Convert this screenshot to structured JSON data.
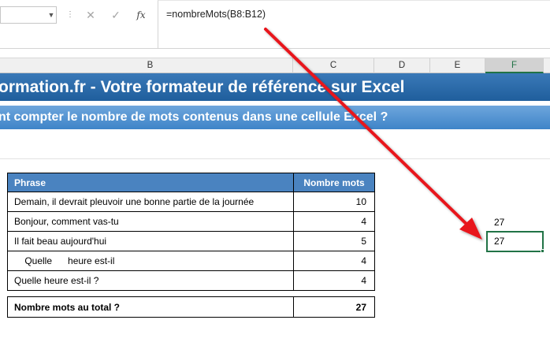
{
  "formula_bar": {
    "name_box_value": "",
    "cancel_icon": "✕",
    "enter_icon": "✓",
    "fx_label": "fx",
    "formula": "=nombreMots(B8:B12)"
  },
  "columns": [
    "B",
    "C",
    "D",
    "E",
    "F"
  ],
  "banner": {
    "title": "ormation.fr - Votre formateur de référence sur Excel",
    "subtitle": "nt compter le nombre de mots contenus dans une cellule Excel ?"
  },
  "table": {
    "headers": [
      "Phrase",
      "Nombre mots"
    ],
    "rows": [
      {
        "phrase": "Demain, il devrait pleuvoir une bonne partie de la journée",
        "count": "10"
      },
      {
        "phrase": "Bonjour, comment vas-tu",
        "count": "4"
      },
      {
        "phrase": "Il fait beau aujourd'hui",
        "count": "5"
      },
      {
        "phrase": "    Quelle      heure est-il",
        "count": "4"
      },
      {
        "phrase": "Quelle heure est-il ?",
        "count": "4"
      }
    ],
    "total_label": "Nombre mots au total ?",
    "total_value": "27"
  },
  "column_f": {
    "value_1": "27",
    "active_value": "27"
  },
  "colors": {
    "title_bg": "#1f5e9c",
    "subtitle_bg": "#3e84c8",
    "header_bg": "#4a83c0",
    "selection": "#217346",
    "arrow": "#e8141c"
  }
}
